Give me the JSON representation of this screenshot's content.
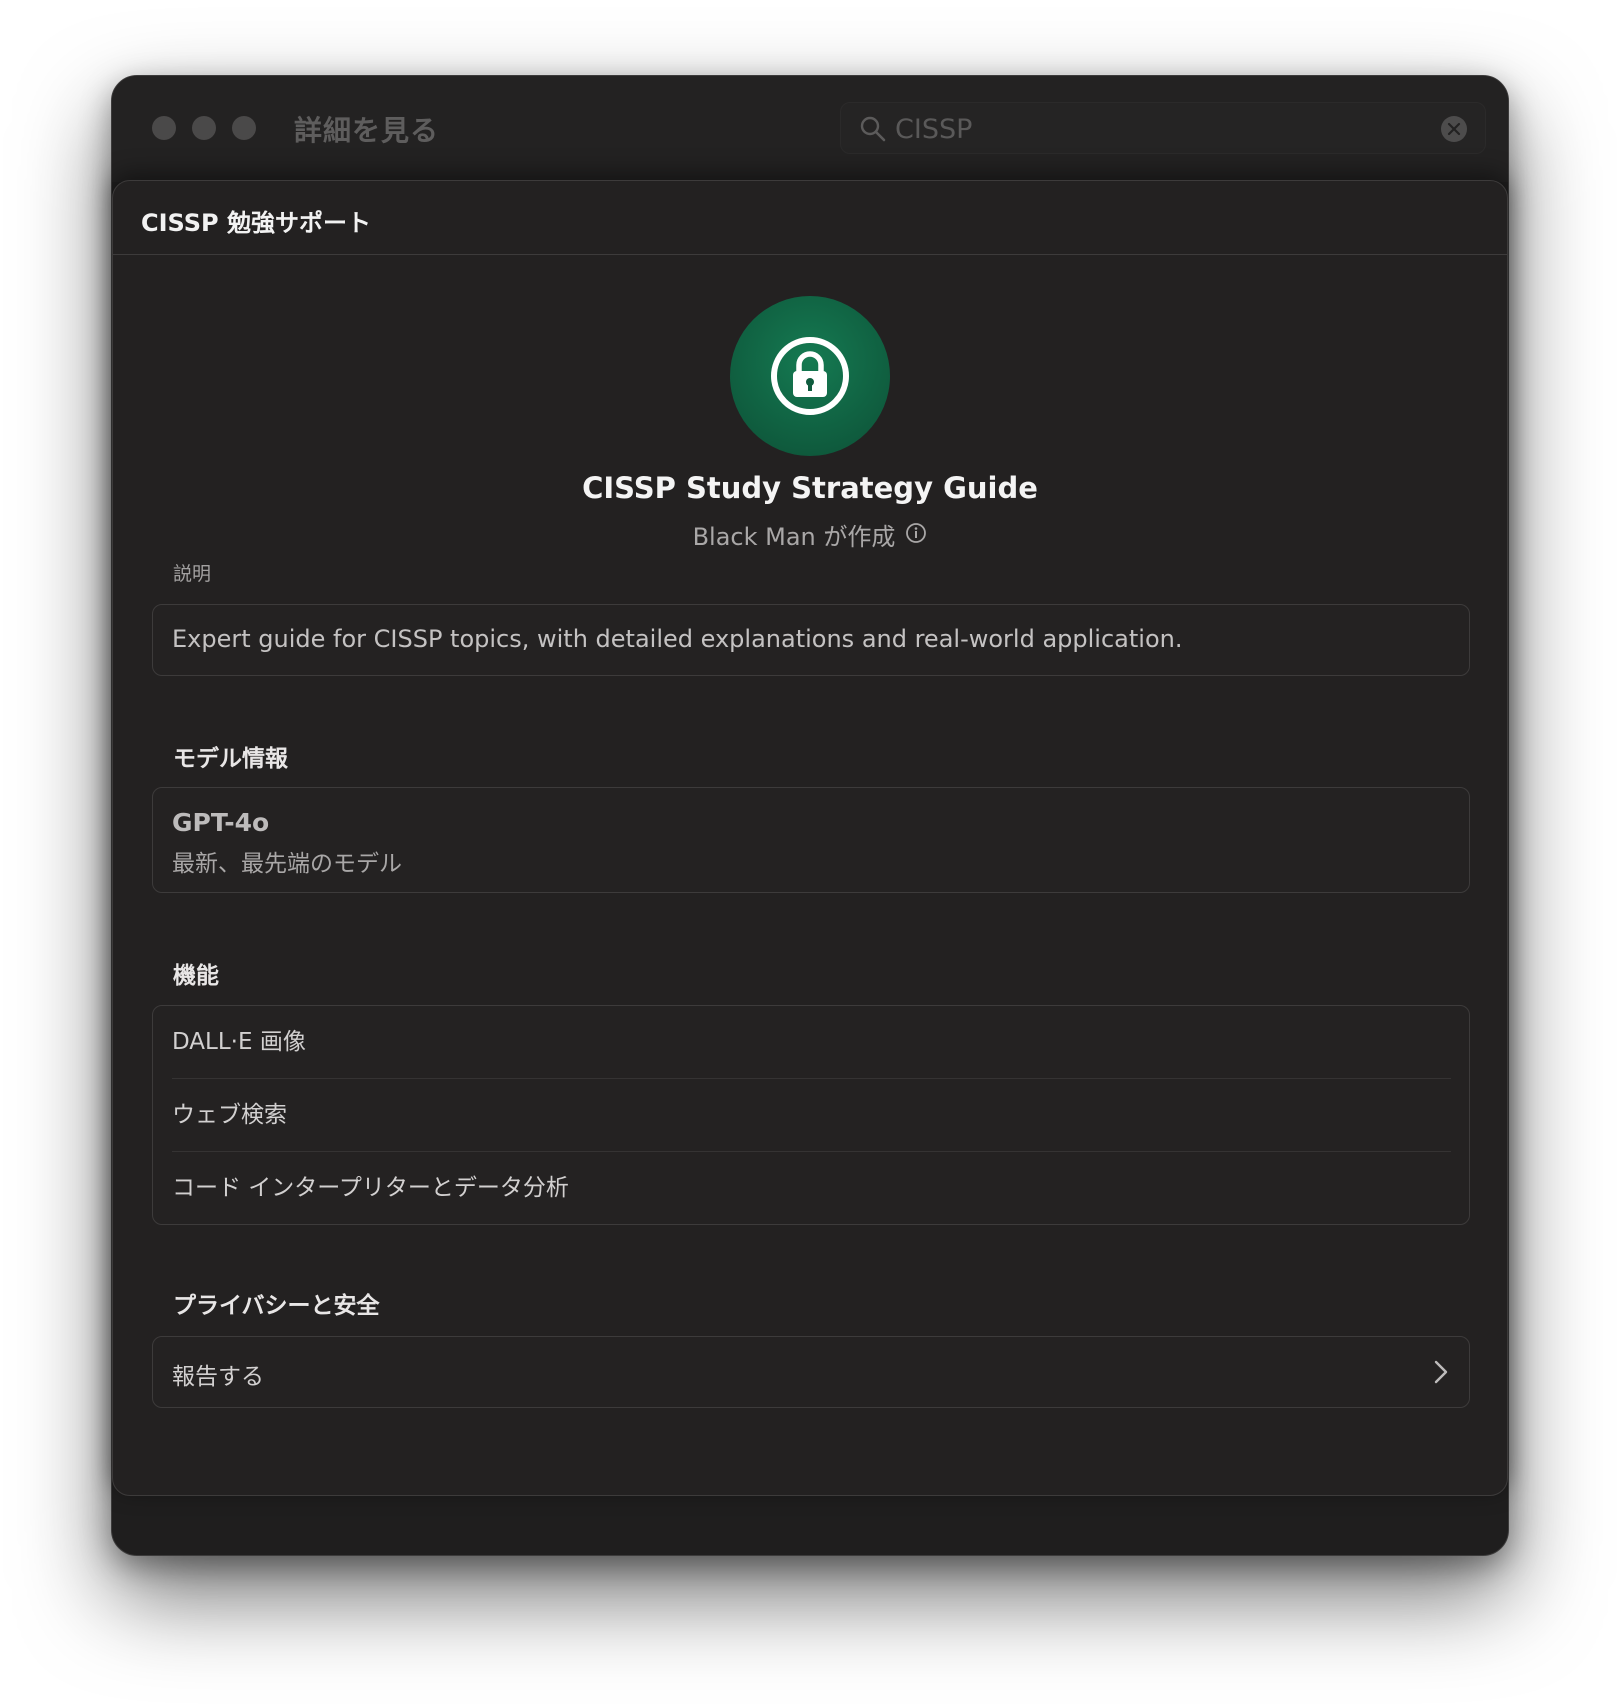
{
  "window": {
    "title": "詳細を見る",
    "search": {
      "value": "CISSP",
      "placeholder": "CISSP"
    }
  },
  "sheet": {
    "header_title": "CISSP 勉強サポート",
    "gpt": {
      "name": "CISSP Study Strategy Guide",
      "creator": "Black Man が作成",
      "avatar_icon": "lock-icon",
      "avatar_color": "#0f5c3e"
    },
    "description": {
      "label": "説明",
      "text": "Expert guide for CISSP topics, with detailed explanations and real-world application."
    },
    "model": {
      "heading": "モデル情報",
      "name": "GPT-4o",
      "desc": "最新、最先端のモデル"
    },
    "capabilities": {
      "heading": "機能",
      "items": [
        "DALL·E 画像",
        "ウェブ検索",
        "コード インタープリターとデータ分析"
      ]
    },
    "privacy": {
      "heading": "プライバシーと安全",
      "report_label": "報告する"
    }
  }
}
